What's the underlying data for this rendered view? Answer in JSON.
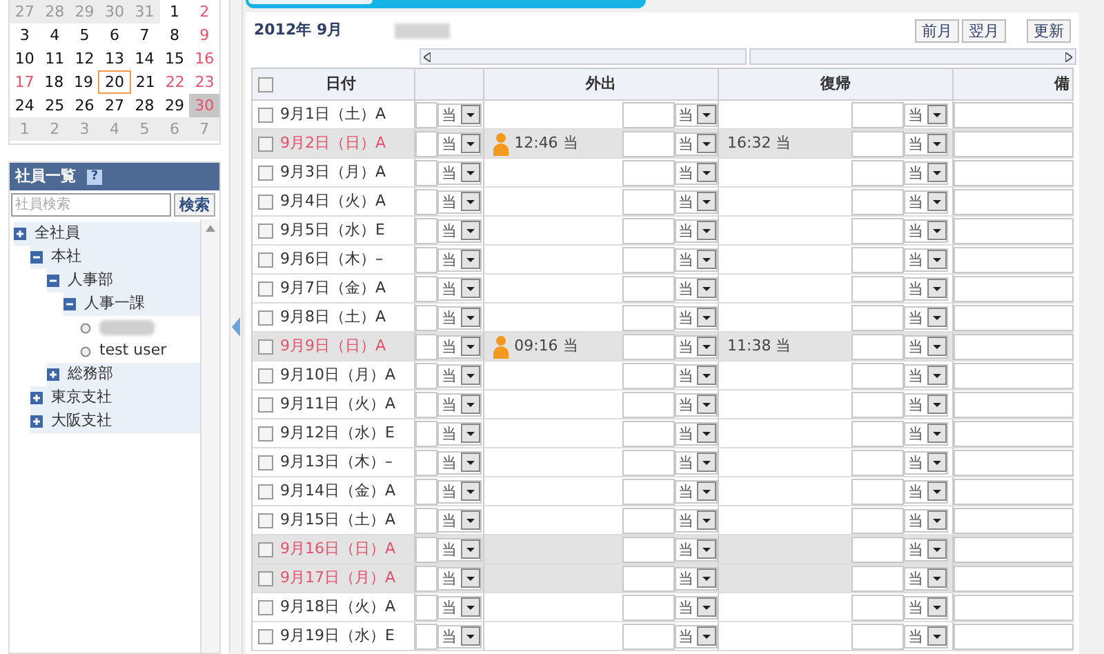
{
  "calendar": {
    "weeks": [
      [
        {
          "day": "27",
          "muted": true
        },
        {
          "day": "28",
          "muted": true
        },
        {
          "day": "29",
          "muted": true
        },
        {
          "day": "30",
          "muted": true
        },
        {
          "day": "31",
          "muted": true
        },
        {
          "day": "1",
          "muted": false,
          "holiday": false
        },
        {
          "day": "2",
          "muted": false,
          "holiday": true
        }
      ],
      [
        {
          "day": "3",
          "muted": false,
          "holiday": false
        },
        {
          "day": "4",
          "muted": false,
          "holiday": false
        },
        {
          "day": "5",
          "muted": false,
          "holiday": false
        },
        {
          "day": "6",
          "muted": false,
          "holiday": false
        },
        {
          "day": "7",
          "muted": false,
          "holiday": false
        },
        {
          "day": "8",
          "muted": false,
          "holiday": false
        },
        {
          "day": "9",
          "muted": false,
          "holiday": true
        }
      ],
      [
        {
          "day": "10",
          "muted": false,
          "holiday": false
        },
        {
          "day": "11",
          "muted": false,
          "holiday": false
        },
        {
          "day": "12",
          "muted": false,
          "holiday": false
        },
        {
          "day": "13",
          "muted": false,
          "holiday": false
        },
        {
          "day": "14",
          "muted": false,
          "holiday": false
        },
        {
          "day": "15",
          "muted": false,
          "holiday": false
        },
        {
          "day": "16",
          "muted": false,
          "holiday": true
        }
      ],
      [
        {
          "day": "17",
          "muted": false,
          "holiday": true
        },
        {
          "day": "18",
          "muted": false,
          "holiday": false
        },
        {
          "day": "19",
          "muted": false,
          "holiday": false
        },
        {
          "day": "20",
          "muted": false,
          "holiday": false,
          "today": true
        },
        {
          "day": "21",
          "muted": false,
          "holiday": false
        },
        {
          "day": "22",
          "muted": false,
          "holiday": true
        },
        {
          "day": "23",
          "muted": false,
          "holiday": true
        }
      ],
      [
        {
          "day": "24",
          "muted": false,
          "holiday": false
        },
        {
          "day": "25",
          "muted": false,
          "holiday": false
        },
        {
          "day": "26",
          "muted": false,
          "holiday": false
        },
        {
          "day": "27",
          "muted": false,
          "holiday": false
        },
        {
          "day": "28",
          "muted": false,
          "holiday": false
        },
        {
          "day": "29",
          "muted": false,
          "holiday": false
        },
        {
          "day": "30",
          "muted": false,
          "holiday": true,
          "selected": true
        }
      ],
      [
        {
          "day": "1",
          "muted": true
        },
        {
          "day": "2",
          "muted": true
        },
        {
          "day": "3",
          "muted": true
        },
        {
          "day": "4",
          "muted": true
        },
        {
          "day": "5",
          "muted": true
        },
        {
          "day": "6",
          "muted": true
        },
        {
          "day": "7",
          "muted": true
        }
      ]
    ]
  },
  "employees": {
    "title": "社員一覧",
    "help": "?",
    "search": {
      "placeholder": "社員検索",
      "button": "検索"
    },
    "tree": [
      {
        "kind": "group",
        "label": "全社員",
        "expanded": false,
        "children": [
          {
            "kind": "group",
            "label": "本社",
            "expanded": true,
            "children": [
              {
                "kind": "group",
                "label": "人事部",
                "expanded": true,
                "children": [
                  {
                    "kind": "group",
                    "label": "人事一課",
                    "expanded": true,
                    "children": [
                      {
                        "kind": "blurred_user"
                      },
                      {
                        "kind": "user",
                        "label": "test user"
                      }
                    ]
                  }
                ]
              },
              {
                "kind": "group",
                "label": "総務部",
                "expanded": false
              }
            ]
          },
          {
            "kind": "group",
            "label": "東京支社",
            "expanded": false
          },
          {
            "kind": "group",
            "label": "大阪支社",
            "expanded": false
          }
        ]
      }
    ]
  },
  "header": {
    "month": "2012年 9月",
    "buttons": [
      "前月",
      "翌月",
      "更新"
    ]
  },
  "table": {
    "all_checked": false,
    "columns": [
      "日付",
      "外出",
      "復帰",
      "備"
    ],
    "rows": [
      {
        "date": "9月1日（土）A",
        "holiday": false,
        "checked": false,
        "selects": [
          "当",
          "当",
          "当"
        ]
      },
      {
        "date": "9月2日（日）A",
        "holiday": true,
        "checked": false,
        "selects": [
          "当",
          "当",
          "当"
        ],
        "out": "12:46 当",
        "return": "16:32 当"
      },
      {
        "date": "9月3日（月）A",
        "holiday": false,
        "checked": false,
        "selects": [
          "当",
          "当",
          "当"
        ]
      },
      {
        "date": "9月4日（火）A",
        "holiday": false,
        "checked": false,
        "selects": [
          "当",
          "当",
          "当"
        ]
      },
      {
        "date": "9月5日（水）E",
        "holiday": false,
        "checked": false,
        "selects": [
          "当",
          "当",
          "当"
        ]
      },
      {
        "date": "9月6日（木）–",
        "holiday": false,
        "checked": false,
        "selects": [
          "当",
          "当",
          "当"
        ]
      },
      {
        "date": "9月7日（金）A",
        "holiday": false,
        "checked": false,
        "selects": [
          "当",
          "当",
          "当"
        ]
      },
      {
        "date": "9月8日（土）A",
        "holiday": false,
        "checked": false,
        "selects": [
          "当",
          "当",
          "当"
        ]
      },
      {
        "date": "9月9日（日）A",
        "holiday": true,
        "checked": false,
        "selects": [
          "当",
          "当",
          "当"
        ],
        "out": "09:16 当",
        "return": "11:38 当"
      },
      {
        "date": "9月10日（月）A",
        "holiday": false,
        "checked": false,
        "selects": [
          "当",
          "当",
          "当"
        ]
      },
      {
        "date": "9月11日（火）A",
        "holiday": false,
        "checked": false,
        "selects": [
          "当",
          "当",
          "当"
        ]
      },
      {
        "date": "9月12日（水）E",
        "holiday": false,
        "checked": false,
        "selects": [
          "当",
          "当",
          "当"
        ]
      },
      {
        "date": "9月13日（木）–",
        "holiday": false,
        "checked": false,
        "selects": [
          "当",
          "当",
          "当"
        ]
      },
      {
        "date": "9月14日（金）A",
        "holiday": false,
        "checked": false,
        "selects": [
          "当",
          "当",
          "当"
        ]
      },
      {
        "date": "9月15日（土）A",
        "holiday": false,
        "checked": false,
        "selects": [
          "当",
          "当",
          "当"
        ]
      },
      {
        "date": "9月16日（日）A",
        "holiday": true,
        "checked": false,
        "selects": [
          "当",
          "当",
          "当"
        ]
      },
      {
        "date": "9月17日（月）A",
        "holiday": true,
        "checked": false,
        "selects": [
          "当",
          "当",
          "当"
        ]
      },
      {
        "date": "9月18日（火）A",
        "holiday": false,
        "checked": false,
        "selects": [
          "当",
          "当",
          "当"
        ]
      },
      {
        "date": "9月19日（水）E",
        "holiday": false,
        "checked": false,
        "selects": [
          "当",
          "当",
          "当"
        ]
      }
    ]
  }
}
